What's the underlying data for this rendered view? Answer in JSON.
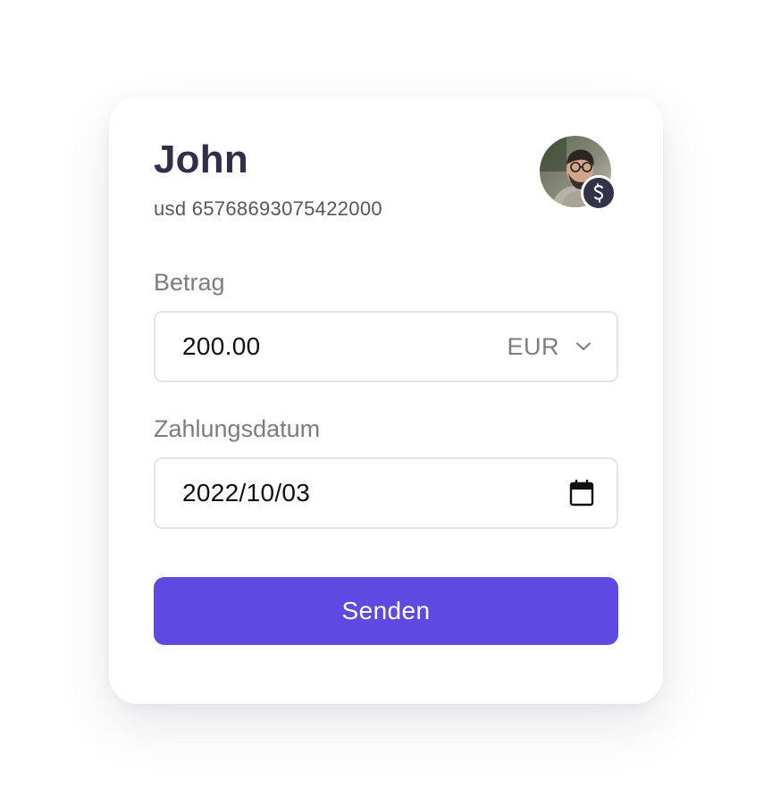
{
  "recipient": {
    "name": "John",
    "account": "usd 65768693075422000",
    "avatar_icon": "user-photo",
    "badge_icon": "currency-badge-icon"
  },
  "amount": {
    "label": "Betrag",
    "value": "200.00",
    "currency": "EUR"
  },
  "payment_date": {
    "label": "Zahlungsdatum",
    "value": "2022/10/03"
  },
  "submit": {
    "label": "Senden"
  },
  "colors": {
    "primary": "#5d4ae3",
    "title": "#2f2f4a",
    "muted": "#7c7c84",
    "border": "#e3e3e7",
    "badge": "#323249"
  }
}
